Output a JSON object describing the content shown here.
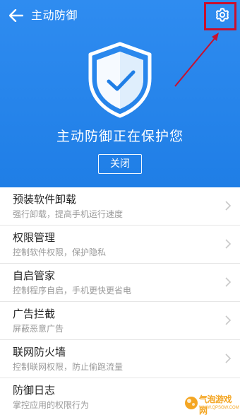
{
  "header": {
    "title": "主动防御",
    "back_icon": "arrow-left-icon",
    "settings_icon": "gear-icon"
  },
  "hero": {
    "status_text": "主动防御正在保护您",
    "close_label": "关闭",
    "shield_icon": "shield-check-icon"
  },
  "items": [
    {
      "title": "预装软件卸载",
      "subtitle": "强行卸载，提高手机运行速度"
    },
    {
      "title": "权限管理",
      "subtitle": "控制软件权限，保护隐私"
    },
    {
      "title": "自启管家",
      "subtitle": "控制程序自启，手机更快更省电"
    },
    {
      "title": "广告拦截",
      "subtitle": "屏蔽恶意广告"
    },
    {
      "title": "联网防火墙",
      "subtitle": "控制联网权限，防止偷跑流量"
    },
    {
      "title": "防御日志",
      "subtitle": "掌控应用的权限行为"
    }
  ],
  "watermark": {
    "main": "气泡游戏网",
    "sub": "WWW.QPSGW.COM"
  },
  "colors": {
    "primary_blue": "#1f7ee6",
    "annotation_red": "#c8102e",
    "watermark_orange": "#f4a623"
  }
}
